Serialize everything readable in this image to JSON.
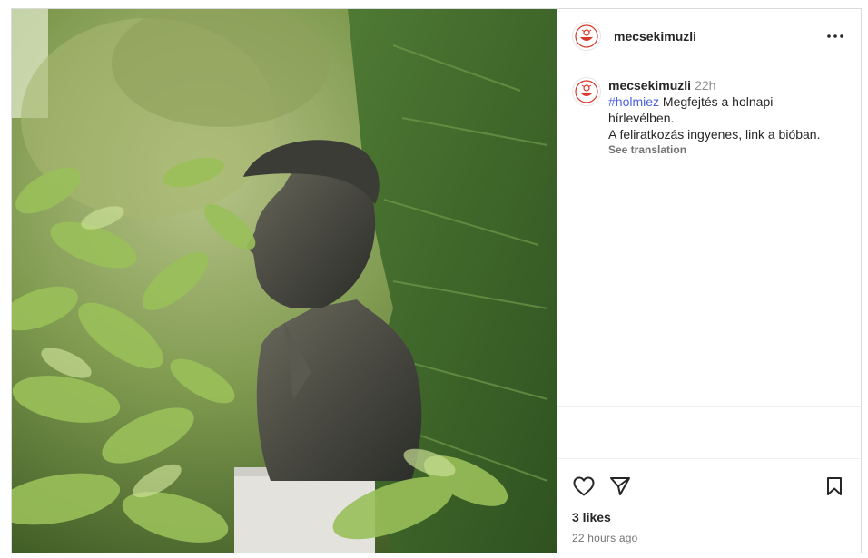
{
  "post": {
    "username": "mecsekimuzli",
    "photo_alt": "Bronze bust among green foliage",
    "caption": {
      "username": "mecsekimuzli",
      "time": "22h",
      "hashtag": "#holmiez",
      "line1_rest": "Megfejtés a holnapi",
      "line2": "hírlevélben.",
      "line3": "A feliratkozás ingyenes, link a bióban.",
      "see_translation": "See translation"
    },
    "likes": "3 likes",
    "timestamp": "22 hours ago"
  },
  "icons": {
    "more": "more-options-icon",
    "like": "heart-icon",
    "share": "paper-plane-icon",
    "save": "bookmark-icon"
  },
  "colors": {
    "hashtag": "#4a5fe0",
    "secondary_text": "#737373",
    "border": "#dbdbdb",
    "avatar_accent": "#d9382c"
  }
}
